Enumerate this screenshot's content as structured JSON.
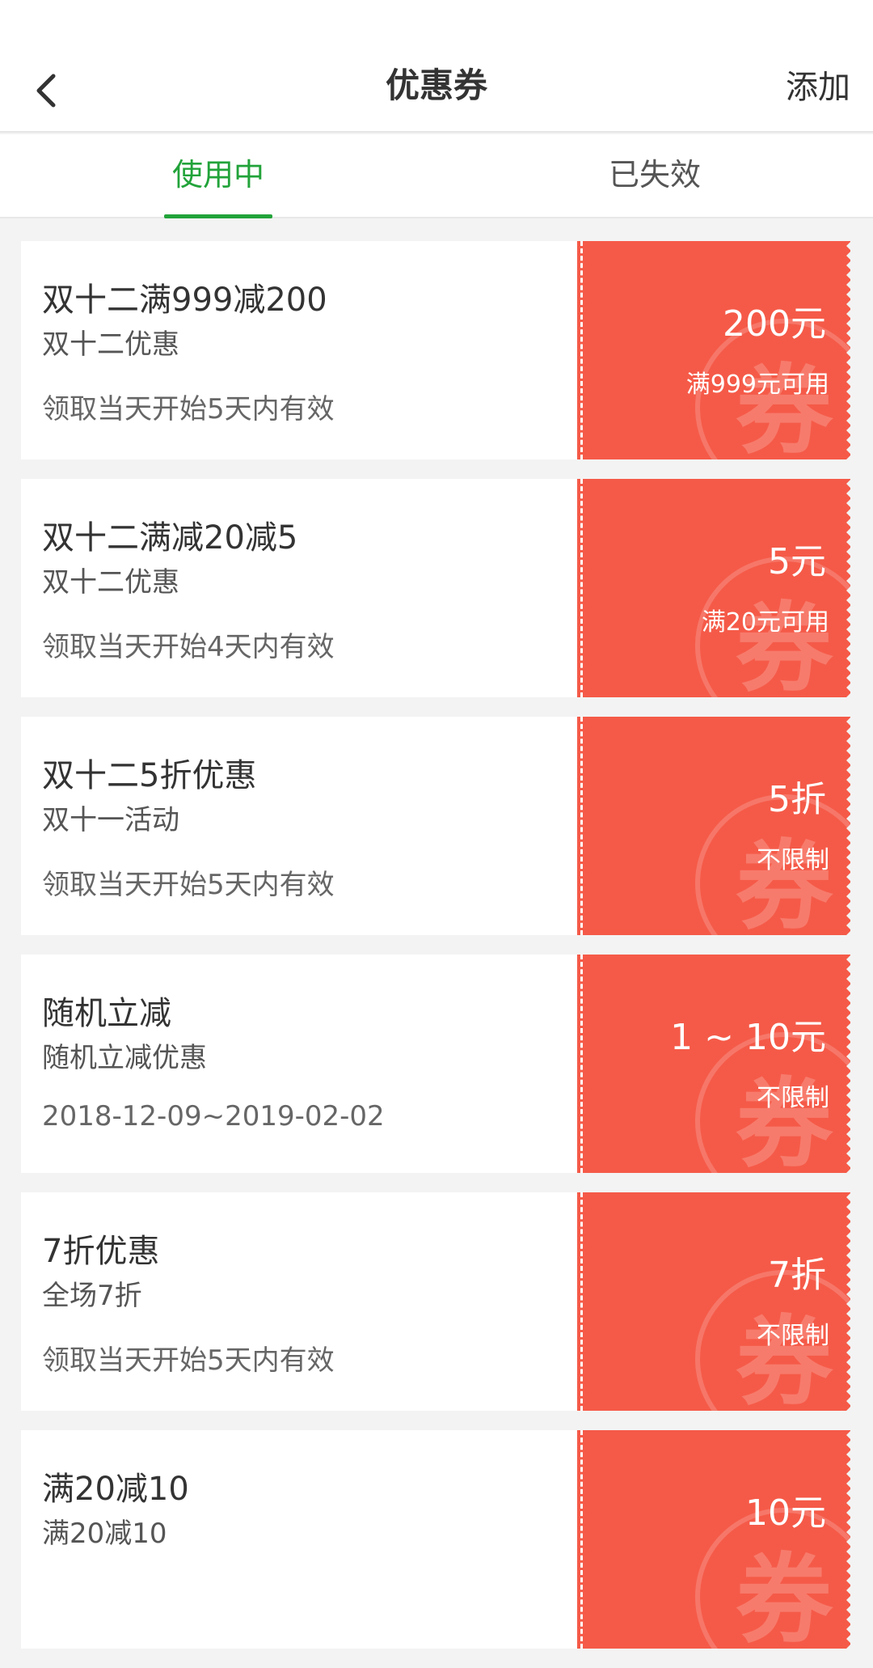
{
  "header": {
    "title": "优惠券",
    "add_label": "添加",
    "back_icon": "chevron-left-icon"
  },
  "tabs": [
    {
      "label": "使用中",
      "active": true
    },
    {
      "label": "已失效",
      "active": false
    }
  ],
  "colors": {
    "accent": "#22a33a",
    "coupon_red": "#f55a48"
  },
  "coupons": [
    {
      "name": "双十二满999减200",
      "desc": "双十二优惠",
      "validity": "领取当天开始5天内有效",
      "amount": "200元",
      "condition": "满999元可用"
    },
    {
      "name": "双十二满减20减5",
      "desc": "双十二优惠",
      "validity": "领取当天开始4天内有效",
      "amount": "5元",
      "condition": "满20元可用"
    },
    {
      "name": "双十二5折优惠",
      "desc": "双十一活动",
      "validity": "领取当天开始5天内有效",
      "amount": "5折",
      "condition": "不限制"
    },
    {
      "name": "随机立减",
      "desc": "随机立减优惠",
      "validity": "2018-12-09~2019-02-02",
      "amount": "1 ~ 10元",
      "condition": "不限制"
    },
    {
      "name": "7折优惠",
      "desc": "全场7折",
      "validity": "领取当天开始5天内有效",
      "amount": "7折",
      "condition": "不限制"
    },
    {
      "name": "满20减10",
      "desc": "满20减10",
      "validity": "",
      "amount": "10元",
      "condition": ""
    }
  ]
}
